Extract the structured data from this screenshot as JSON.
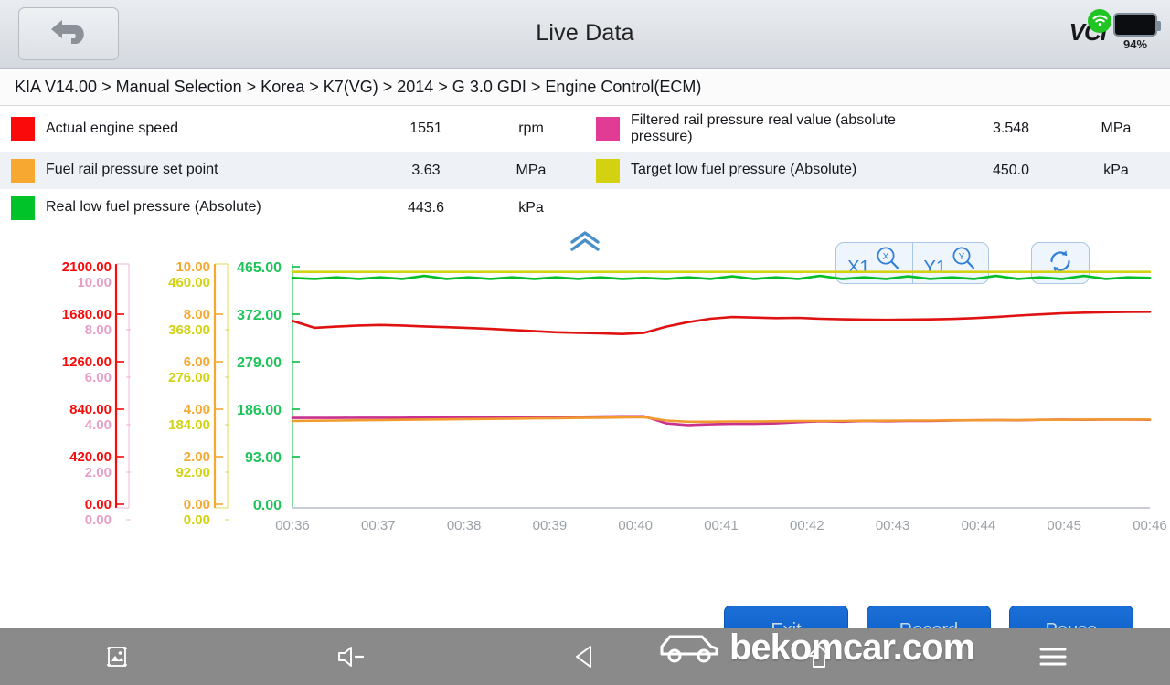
{
  "titlebar": {
    "back_icon": "back-arrow-icon",
    "title": "Live Data",
    "vci_label": "VCI",
    "wifi_icon": "wifi-icon",
    "battery_percent": "94%"
  },
  "breadcrumb": {
    "text": "KIA V14.00 > Manual Selection  > Korea  > K7(VG)  > 2014  > G 3.0 GDI  > Engine Control(ECM)"
  },
  "parameters": [
    {
      "color": "#FA0A0A",
      "name": "Actual engine speed",
      "value": "1551",
      "unit": "rpm"
    },
    {
      "color": "#E23B95",
      "name": "Filtered rail pressure real value (absolute pressure)",
      "value": "3.548",
      "unit": "MPa"
    },
    {
      "color": "#F7A830",
      "name": "Fuel rail pressure set point",
      "value": "3.63",
      "unit": "MPa"
    },
    {
      "color": "#D2D211",
      "name": "Target low fuel pressure (Absolute)",
      "value": "450.0",
      "unit": "kPa"
    },
    {
      "color": "#00C32A",
      "name": "Real low fuel pressure (Absolute)",
      "value": "443.6",
      "unit": "kPa"
    }
  ],
  "collapse": {
    "icon": "chevron-double-up-icon"
  },
  "toolbar": {
    "x_zoom_label": "X1",
    "x_zoom_icon": "magnifier-x-icon",
    "y_zoom_label": "Y1",
    "y_zoom_icon": "magnifier-y-icon",
    "refresh_icon": "refresh-icon"
  },
  "actions": [
    {
      "label": "Exit",
      "icon": "speaker-plus-icon"
    },
    {
      "label": "Record",
      "icon": "car-icon"
    },
    {
      "label": "Pause",
      "icon": "video-camera-icon"
    }
  ],
  "navbar": [
    {
      "icon": "screenshot-icon"
    },
    {
      "icon": "volume-down-icon"
    },
    {
      "icon": "back-triangle-icon"
    },
    {
      "icon": "home-icon"
    },
    {
      "icon": "menu-icon"
    }
  ],
  "watermark": {
    "text": "bekomcar.com",
    "icon": "car-icon"
  },
  "chart_data": {
    "type": "line",
    "title": "",
    "xlabel": "",
    "ylabel": "",
    "grid": false,
    "legend_position": "top",
    "x_ticks": [
      "00:36",
      "00:37",
      "00:38",
      "00:39",
      "00:40",
      "00:41",
      "00:42",
      "00:43",
      "00:44",
      "00:45",
      "00:46"
    ],
    "axes": [
      {
        "name": "Actual engine speed",
        "color": "#FA0A0A",
        "unit": "rpm",
        "ticks": [
          "2100.00",
          "1680.00",
          "1260.00",
          "840.00",
          "420.00",
          "0.00"
        ],
        "ylim": [
          0,
          2100
        ]
      },
      {
        "name": "Filtered rail pressure real value (absolute pressure)",
        "color": "#E79FC8",
        "unit": "MPa",
        "ticks": [
          "10.00",
          "8.00",
          "6.00",
          "4.00",
          "2.00",
          "0.00"
        ],
        "ylim": [
          0,
          10
        ]
      },
      {
        "name": "Fuel rail pressure set point",
        "color": "#F7A830",
        "unit": "MPa",
        "ticks": [
          "10.00",
          "8.00",
          "6.00",
          "4.00",
          "2.00",
          "0.00"
        ],
        "ylim": [
          0,
          10
        ]
      },
      {
        "name": "Target low fuel pressure (Absolute)",
        "color": "#D2D211",
        "unit": "kPa",
        "ticks": [
          "460.00",
          "368.00",
          "276.00",
          "184.00",
          "92.00",
          "0.00"
        ],
        "ylim": [
          0,
          460
        ]
      },
      {
        "name": "Real low fuel pressure (Absolute)",
        "color": "#00C32A",
        "unit": "kPa",
        "ticks": [
          "465.00",
          "372.00",
          "279.00",
          "186.00",
          "93.00",
          "0.00"
        ],
        "ylim": [
          0,
          465
        ]
      }
    ],
    "series": [
      {
        "name": "Actual engine speed",
        "color": "#DF1111",
        "unit": "rpm",
        "values": [
          1620,
          1560,
          1570,
          1580,
          1585,
          1580,
          1572,
          1565,
          1558,
          1550,
          1540,
          1530,
          1520,
          1515,
          1510,
          1505,
          1515,
          1570,
          1610,
          1640,
          1655,
          1650,
          1645,
          1648,
          1640,
          1635,
          1632,
          1630,
          1632,
          1634,
          1638,
          1645,
          1655,
          1668,
          1678,
          1688,
          1694,
          1698,
          1700,
          1702
        ]
      },
      {
        "name": "Filtered rail pressure real value (absolute pressure)",
        "color": "#C9318E",
        "unit": "MPa",
        "values": [
          3.63,
          3.63,
          3.63,
          3.64,
          3.64,
          3.64,
          3.65,
          3.65,
          3.66,
          3.66,
          3.67,
          3.67,
          3.68,
          3.68,
          3.69,
          3.7,
          3.7,
          3.4,
          3.33,
          3.36,
          3.38,
          3.38,
          3.4,
          3.45,
          3.49,
          3.47,
          3.5,
          3.49,
          3.5,
          3.5,
          3.52,
          3.53,
          3.54,
          3.53,
          3.55,
          3.56,
          3.55,
          3.56,
          3.56,
          3.55
        ]
      },
      {
        "name": "Fuel rail pressure set point",
        "color": "#F29A2E",
        "unit": "MPa",
        "values": [
          3.5,
          3.51,
          3.52,
          3.53,
          3.54,
          3.55,
          3.56,
          3.57,
          3.58,
          3.59,
          3.6,
          3.61,
          3.62,
          3.63,
          3.64,
          3.65,
          3.66,
          3.52,
          3.47,
          3.47,
          3.48,
          3.48,
          3.49,
          3.5,
          3.5,
          3.5,
          3.51,
          3.51,
          3.52,
          3.52,
          3.53,
          3.53,
          3.54,
          3.54,
          3.55,
          3.55,
          3.56,
          3.56,
          3.56,
          3.56
        ]
      },
      {
        "name": "Target low fuel pressure (Absolute)",
        "color": "#D2D211",
        "unit": "kPa",
        "values": [
          450,
          450,
          450,
          450,
          450,
          450,
          450,
          450,
          450,
          450,
          450,
          450,
          450,
          450,
          450,
          450,
          450,
          450,
          450,
          450,
          450,
          450,
          450,
          450,
          450,
          450,
          450,
          450,
          450,
          450,
          450,
          450,
          450,
          450,
          450,
          450,
          450,
          450,
          450,
          450
        ]
      },
      {
        "name": "Real low fuel pressure (Absolute)",
        "color": "#00BE28",
        "unit": "kPa",
        "values": [
          443,
          441,
          444,
          441,
          444,
          441,
          447,
          441,
          444,
          441,
          444,
          441,
          444,
          441,
          444,
          441,
          443,
          441,
          444,
          441,
          446,
          441,
          444,
          441,
          447,
          441,
          444,
          441,
          446,
          441,
          444,
          441,
          447,
          441,
          444,
          441,
          447,
          441,
          444,
          443
        ]
      }
    ]
  }
}
